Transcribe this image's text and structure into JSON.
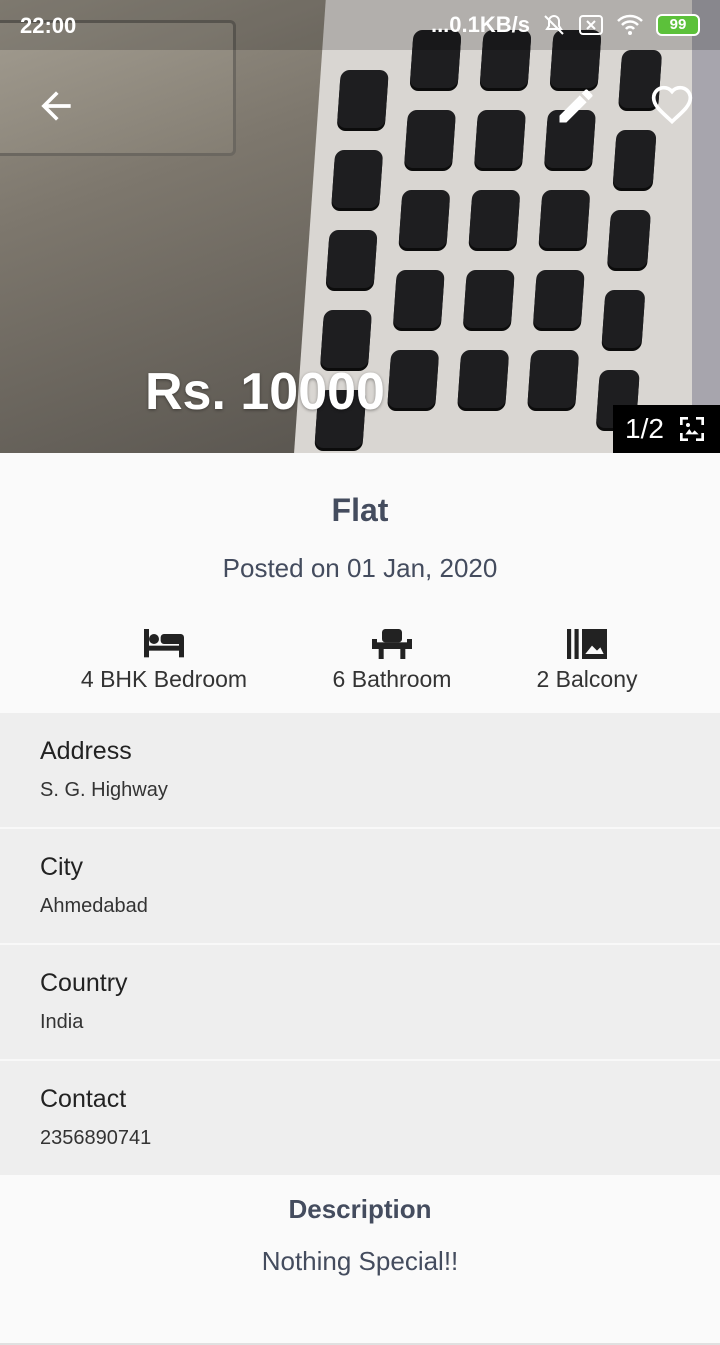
{
  "statusbar": {
    "time": "22:00",
    "net": "...0.1KB/s",
    "battery": "99"
  },
  "hero": {
    "price": "Rs. 10000",
    "counter": "1/2"
  },
  "listing": {
    "title": "Flat",
    "posted": "Posted on 01 Jan, 2020"
  },
  "features": [
    {
      "label": "4 BHK Bedroom",
      "icon": "bed-icon"
    },
    {
      "label": "6 Bathroom",
      "icon": "bathroom-icon"
    },
    {
      "label": "2 Balcony",
      "icon": "balcony-icon"
    }
  ],
  "details": [
    {
      "heading": "Address",
      "value": "S. G. Highway"
    },
    {
      "heading": "City",
      "value": "Ahmedabad"
    },
    {
      "heading": "Country",
      "value": "India"
    },
    {
      "heading": "Contact",
      "value": "2356890741"
    }
  ],
  "description": {
    "heading": "Description",
    "text": "Nothing Special!!"
  }
}
